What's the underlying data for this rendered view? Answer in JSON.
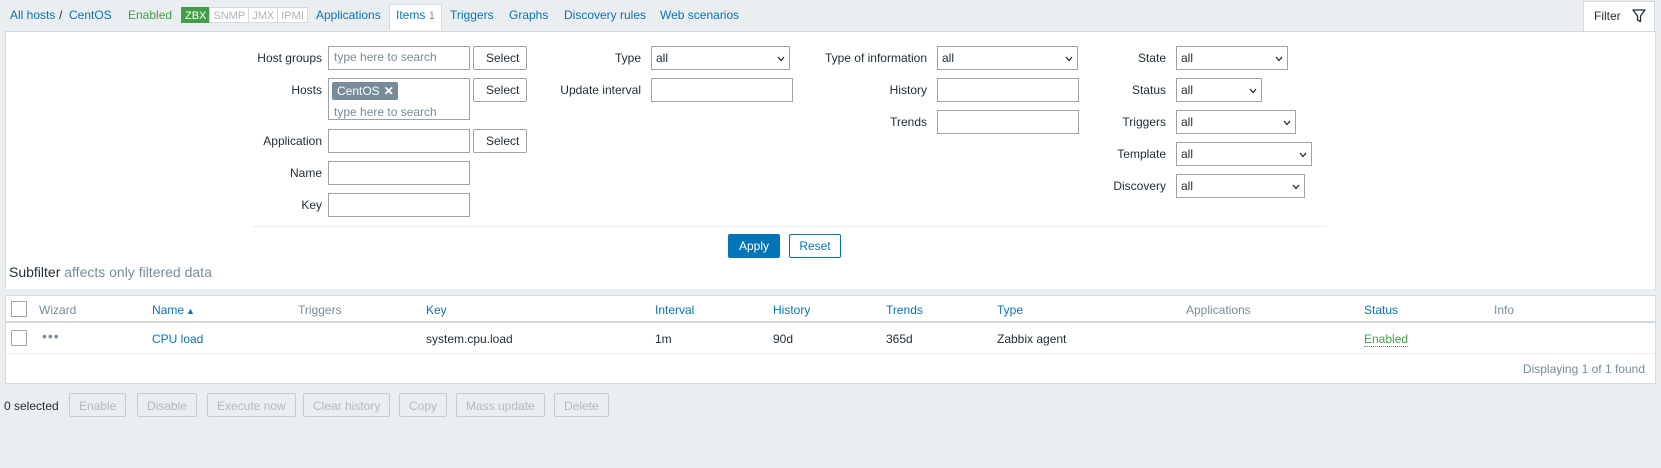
{
  "breadcrumb": {
    "all_hosts": "All hosts",
    "sep": "/",
    "host": "CentOS",
    "status": "Enabled"
  },
  "badges": [
    "ZBX",
    "SNMP",
    "JMX",
    "IPMI"
  ],
  "nav_tabs": {
    "applications": "Applications",
    "items": "Items",
    "items_count": "1",
    "triggers": "Triggers",
    "graphs": "Graphs",
    "discovery_rules": "Discovery rules",
    "web_scenarios": "Web scenarios"
  },
  "filter": {
    "tab_label": "Filter",
    "host_groups_label": "Host groups",
    "host_groups_placeholder": "type here to search",
    "hosts_label": "Hosts",
    "hosts_chip": "CentOS",
    "hosts_placeholder": "type here to search",
    "application_label": "Application",
    "application_value": "",
    "name_label": "Name",
    "name_value": "",
    "key_label": "Key",
    "key_value": "",
    "select_label": "Select",
    "type_label": "Type",
    "type_value": "all",
    "update_interval_label": "Update interval",
    "update_interval_value": "",
    "type_of_info_label": "Type of information",
    "type_of_info_value": "all",
    "history_label": "History",
    "history_value": "",
    "trends_label": "Trends",
    "trends_value": "",
    "state_label": "State",
    "state_value": "all",
    "status_label": "Status",
    "status_value": "all",
    "triggers_label": "Triggers",
    "triggers_value": "all",
    "template_label": "Template",
    "template_value": "all",
    "discovery_label": "Discovery",
    "discovery_value": "all",
    "apply": "Apply",
    "reset": "Reset"
  },
  "subfilter": {
    "title": "Subfilter",
    "note": "affects only filtered data"
  },
  "table": {
    "headers": {
      "wizard": "Wizard",
      "name": "Name",
      "sort_arrow": "▲",
      "triggers": "Triggers",
      "key": "Key",
      "interval": "Interval",
      "history": "History",
      "trends": "Trends",
      "type": "Type",
      "applications": "Applications",
      "status": "Status",
      "info": "Info"
    },
    "rows": [
      {
        "wizard": "•••",
        "name": "CPU load",
        "triggers": "",
        "key": "system.cpu.load",
        "interval": "1m",
        "history": "90d",
        "trends": "365d",
        "type": "Zabbix agent",
        "applications": "",
        "status": "Enabled"
      }
    ],
    "footer": "Displaying 1 of 1 found"
  },
  "actions": {
    "selected_count": "0 selected",
    "enable": "Enable",
    "disable": "Disable",
    "execute_now": "Execute now",
    "clear_history": "Clear history",
    "copy": "Copy",
    "mass_update": "Mass update",
    "delete": "Delete"
  },
  "colors": {
    "link": "#0a73b5",
    "enabled": "#429e47",
    "primary": "#0275b8"
  },
  "icons": {
    "filter": "funnel-icon",
    "chip_remove": "close-icon",
    "dropdown": "chevron-down-icon"
  }
}
